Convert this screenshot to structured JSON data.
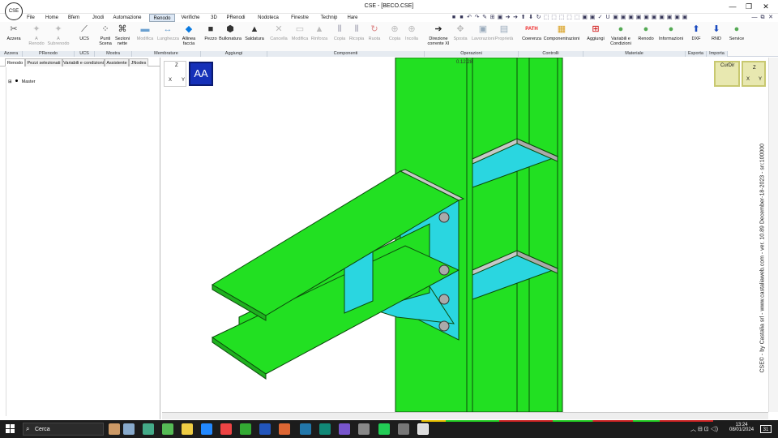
{
  "window": {
    "title": "CSE - [BECO.CSE]",
    "logo_text": "CSE",
    "minimize": "—",
    "maximize": "❐",
    "close": "✕"
  },
  "menu": {
    "items": [
      "File",
      "Home",
      "Bfem",
      "Jnodi",
      "Automazione",
      "Renodo",
      "Verifiche",
      "3D",
      "PRenodi",
      "Nodoteca",
      "Finestre",
      "Technip",
      "Hare"
    ],
    "active": "Renodo"
  },
  "ribbon": {
    "buttons": [
      {
        "label": "Azzera",
        "icon": "✂"
      },
      {
        "label": "A Renodo",
        "icon": "✦",
        "disabled": true
      },
      {
        "label": "A Subrenodo",
        "icon": "✦",
        "disabled": true
      },
      {
        "label": "UCS",
        "icon": "⟋"
      },
      {
        "label": "Punti Scena",
        "icon": "⁘"
      },
      {
        "label": "Sezioni nette",
        "icon": "⌘"
      },
      {
        "label": "Modifica",
        "icon": "▬",
        "disabled": true
      },
      {
        "label": "Lunghezza",
        "icon": "↔",
        "disabled": true
      },
      {
        "label": "Allinea faccia",
        "icon": "◆"
      },
      {
        "label": "Pezzo",
        "icon": "■"
      },
      {
        "label": "Bullonatura",
        "icon": "⬢"
      },
      {
        "label": "Saldatura",
        "icon": "▲"
      },
      {
        "label": "Cancella",
        "icon": "✕",
        "disabled": true
      },
      {
        "label": "Modifica",
        "icon": "▭",
        "disabled": true
      },
      {
        "label": "Rinforza",
        "icon": "▲",
        "disabled": true
      },
      {
        "label": "Copia",
        "icon": "⫴",
        "disabled": true
      },
      {
        "label": "Ricopia",
        "icon": "⫴",
        "disabled": true
      },
      {
        "label": "Ruota",
        "icon": "↻",
        "disabled": true
      },
      {
        "label": "Copia",
        "icon": "⊕",
        "disabled": true
      },
      {
        "label": "Incolla",
        "icon": "⊕",
        "disabled": true
      },
      {
        "label": "Direzione corrente XI",
        "icon": "➔"
      },
      {
        "label": "Sposta",
        "icon": "✥",
        "disabled": true
      },
      {
        "label": "Lavorazioni",
        "icon": "▣",
        "disabled": true
      },
      {
        "label": "Proprietà",
        "icon": "▤",
        "disabled": true
      },
      {
        "label": "Coerenza",
        "icon": "PATH"
      },
      {
        "label": "Componentrazioni",
        "icon": "▦"
      },
      {
        "label": "Aggiungi",
        "icon": "⊞"
      },
      {
        "label": "Variabili e Condizioni",
        "icon": "●"
      },
      {
        "label": "Renodo",
        "icon": "●"
      },
      {
        "label": "Informazioni",
        "icon": "●"
      },
      {
        "label": "DXF",
        "icon": "⬆"
      },
      {
        "label": "RND",
        "icon": "⬇"
      },
      {
        "label": "Service",
        "icon": "●"
      }
    ],
    "groups": [
      "Azzera",
      "PRenodo",
      "UCS",
      "Mostra",
      "Membrature",
      "Aggiungi",
      "Componenti",
      "Operazioni",
      "Controlli",
      "Materiale",
      "Esporta",
      "Importa"
    ]
  },
  "panel": {
    "tabs": [
      "Renodo",
      "Pezzi selezionati",
      "Variabili e condizioni",
      "Assistente",
      "JNodes"
    ],
    "active_tab": "Renodo",
    "tree": [
      {
        "label": "Master",
        "expander": "⊞"
      }
    ]
  },
  "viewport": {
    "axis_label_z": "Z",
    "axis_label_x": "X",
    "axis_label_y": "Y",
    "aa_label": "AA",
    "top_label": "0.12.28",
    "curdir_label": "CurDir",
    "side_text": "CSE© - by Castalia srl - www.castaliaweb.com - ver. 10.89 December-18-2023 - sn:100000",
    "colors": {
      "steel": "#22e022",
      "plate": "#2ad6e0",
      "edge": "#0c4a0c"
    }
  },
  "taskbar": {
    "search_placeholder": "Cerca",
    "time": "13:24",
    "date": "08/01/2024",
    "notification_count": "31"
  }
}
